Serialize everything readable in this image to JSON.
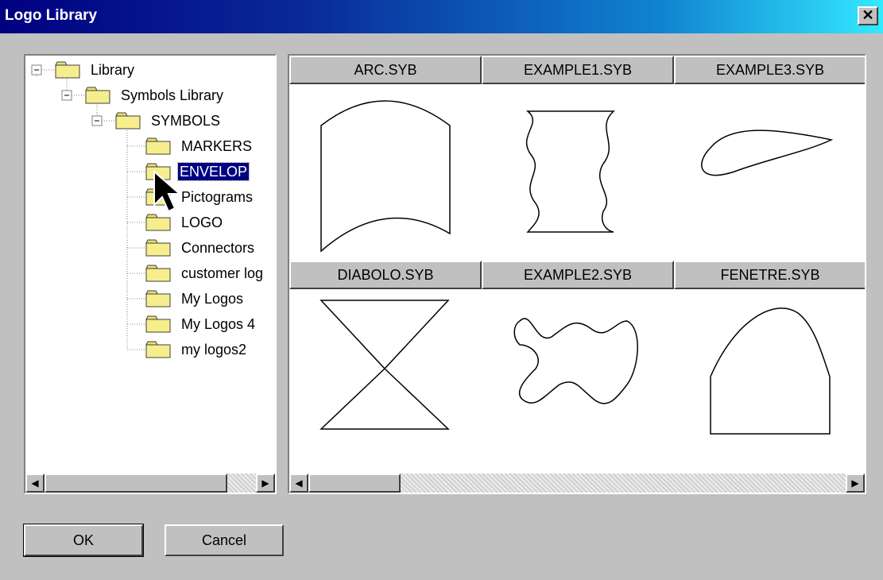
{
  "window": {
    "title": "Logo Library"
  },
  "tree": {
    "root": "Library",
    "level1": "Symbols Library",
    "level2": "SYMBOLS",
    "items": [
      "MARKERS",
      "ENVELOP",
      "Pictograms",
      "LOGO",
      "Connectors",
      "customer log",
      "My Logos",
      "My Logos 4",
      "my logos2"
    ],
    "selected": "ENVELOP"
  },
  "thumbnails": [
    {
      "label": "ARC.SYB",
      "icon": "arc-shape"
    },
    {
      "label": "EXAMPLE1.SYB",
      "icon": "wavy-hourglass-shape"
    },
    {
      "label": "EXAMPLE3.SYB",
      "icon": "teardrop-shape"
    },
    {
      "label": "DIABOLO.SYB",
      "icon": "hourglass-shape"
    },
    {
      "label": "EXAMPLE2.SYB",
      "icon": "wavy-fish-shape"
    },
    {
      "label": "FENETRE.SYB",
      "icon": "arched-window-shape"
    }
  ],
  "buttons": {
    "ok": "OK",
    "cancel": "Cancel"
  },
  "colors": {
    "title_start": "#000080",
    "title_end": "#34e8ff",
    "selection": "#000080",
    "face": "#c0c0c0"
  }
}
